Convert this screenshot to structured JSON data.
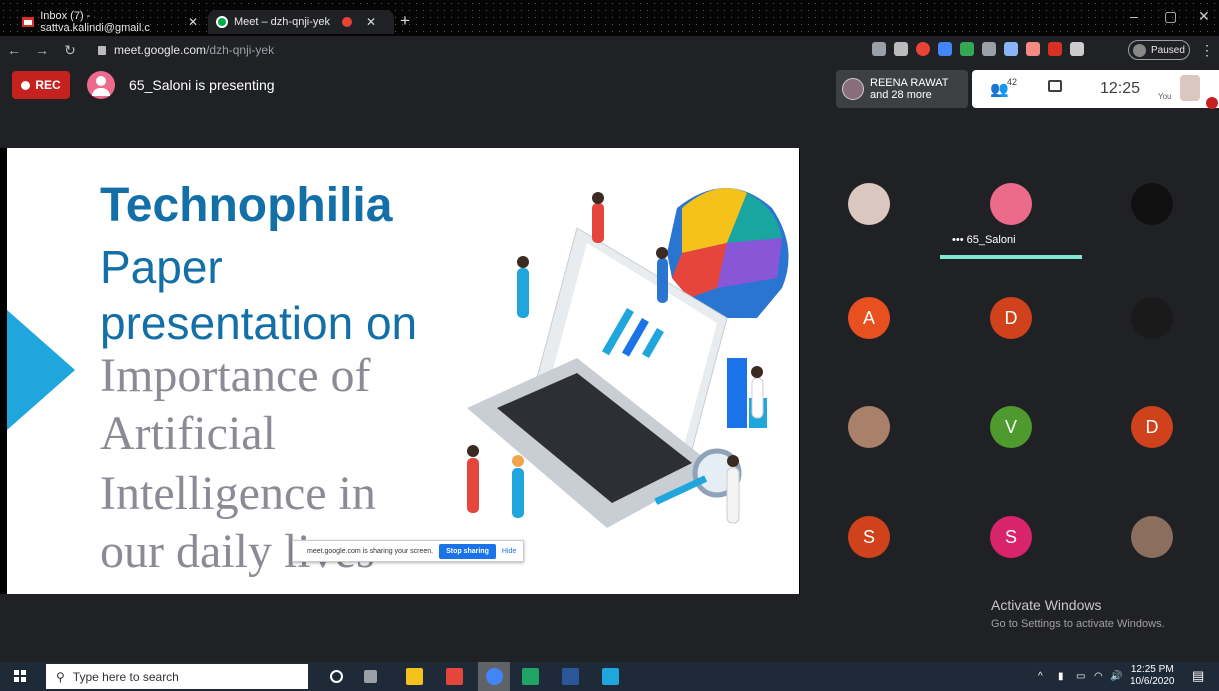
{
  "browser": {
    "tabs": [
      {
        "title": "Inbox (7) - sattva.kalindi@gmail.c",
        "icon": "gmail-icon"
      },
      {
        "title": "Meet – dzh-qnji-yek",
        "icon": "meet-icon"
      }
    ],
    "url_host": "meet.google.com",
    "url_path": "/dzh-qnji-yek",
    "profile_status": "Paused"
  },
  "meet": {
    "rec_label": "REC",
    "presenting_text": "65_Saloni is presenting",
    "people_chip_line1": "REENA RAWAT",
    "people_chip_line2": "and 28 more",
    "participant_count": "42",
    "time": "12:25",
    "you_label": "You"
  },
  "slide": {
    "title": "Technophilia",
    "line1": "Paper",
    "line2": "presentation on",
    "line3": "Importance of",
    "line4": "Artificial",
    "line5": "Intelligence in",
    "line6": "our daily lives"
  },
  "share_bar": {
    "message": "meet.google.com is sharing your screen.",
    "stop_label": "Stop sharing",
    "hide_label": "Hide"
  },
  "participants": [
    {
      "initial": "",
      "color": "#d9c7c0",
      "kind": "photo"
    },
    {
      "initial": "",
      "color": "#ec6b8b",
      "kind": "person"
    },
    {
      "initial": "",
      "color": "#111111",
      "kind": "photo"
    },
    {
      "initial": "A",
      "color": "#e8501f"
    },
    {
      "initial": "D",
      "color": "#d0421b"
    },
    {
      "initial": "",
      "color": "#1a1a1a",
      "kind": "pumpkin"
    },
    {
      "initial": "",
      "color": "#a9806a",
      "kind": "photo"
    },
    {
      "initial": "V",
      "color": "#4e9a2e"
    },
    {
      "initial": "D",
      "color": "#d0421b"
    },
    {
      "initial": "S",
      "color": "#d0421b"
    },
    {
      "initial": "S",
      "color": "#d8246b"
    },
    {
      "initial": "",
      "color": "#8b6e5e",
      "kind": "photo"
    }
  ],
  "speaking": {
    "name": "65_Saloni"
  },
  "watermark": {
    "line1": "Activate Windows",
    "line2": "Go to Settings to activate Windows."
  },
  "taskbar": {
    "search_placeholder": "Type here to search",
    "time": "12:25 PM",
    "date": "10/6/2020"
  }
}
